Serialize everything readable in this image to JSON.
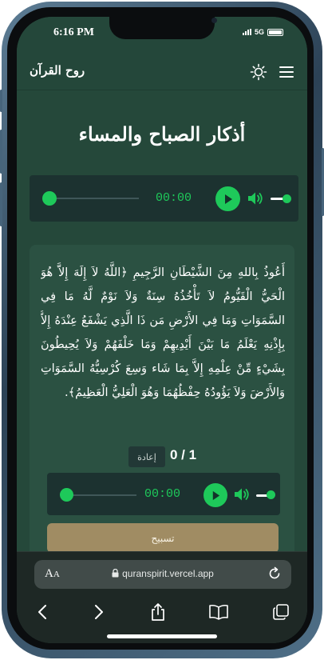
{
  "status_bar": {
    "time": "6:16 PM",
    "network": "5G"
  },
  "header": {
    "site_title": "روح القرآن",
    "theme_icon": "sun-icon",
    "menu_icon": "hamburger-menu-icon"
  },
  "page": {
    "title": "أذكار الصباح والمساء"
  },
  "main_player": {
    "current_time": "00:00",
    "progress": 0,
    "volume": 0.6
  },
  "dhikr": {
    "text": "أَعُوذُ بِاللهِ مِنَ الشَّيْطَانِ الرَّجِيمِ ﴿اللَّهُ لاَ إِلَهَ إِلاَّ هُوَ الْحَيُّ الْقَيُّومُ لاَ تَأْخُذُهُ سِنَةٌ وَلاَ نَوْمٌ لَّهُ مَا فِي السَّمَوَاتِ وَمَا فِي الأَرْضِ مَن ذَا الَّذِي يَشْفَعُ عِنْدَهُ إِلاَّ بِإِذْنِهِ يَعْلَمُ مَا بَيْنَ أَيْدِيهِمْ وَمَا خَلْفَهُمْ وَلاَ يُحِيطُونَ بِشَيْءٍ مِّنْ عِلْمِهِ إِلاَّ بِمَا شَاء وَسِعَ كُرْسِيُّهُ السَّمَوَاتِ وَالأَرْضَ وَلاَ يَؤُودُهُ حِفْظُهُمَا وَهُوَ الْعَلِيُّ الْعَظِيمُ﴾.",
    "reset_label": "إعادة",
    "count": "0 / 1",
    "player": {
      "current_time": "00:00",
      "progress": 0,
      "volume": 0.6
    },
    "tasbih_label": "تسبيح"
  },
  "browser": {
    "text_size_label": "AA",
    "url": "quranspirit.vercel.app",
    "toolbar": [
      "back-icon",
      "forward-icon",
      "share-icon",
      "bookmarks-icon",
      "tabs-icon"
    ]
  }
}
